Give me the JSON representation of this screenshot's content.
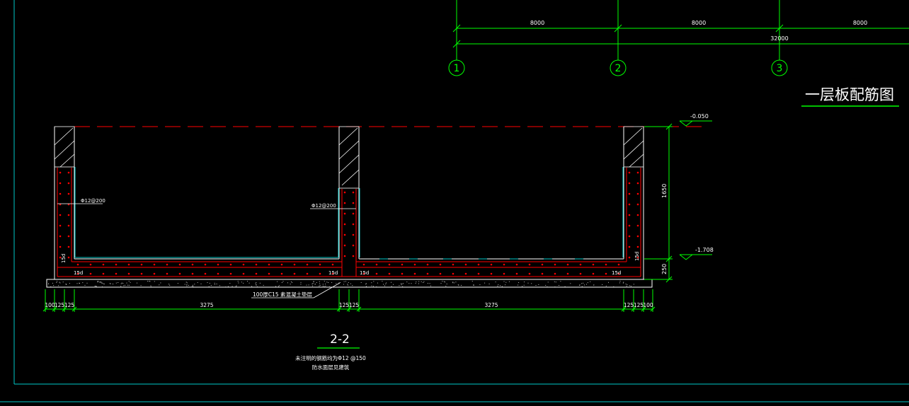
{
  "colors": {
    "background": "#000000",
    "frame": "#00c8c8",
    "grid": "#00ff00",
    "dim": "#00ff00",
    "concrete": "#ffffff",
    "rebar": "#ff0000",
    "text": "#ffffff",
    "leader": "#00c8c8",
    "elevation": "#00ff00"
  },
  "plan": {
    "span_dims": [
      "8000",
      "8000",
      "8000"
    ],
    "total_dim": "32000",
    "axes": [
      "1",
      "2",
      "3"
    ],
    "title": "一层板配筋图"
  },
  "section": {
    "elev_top": "-0.050",
    "elev_bottom": "-1.708",
    "height_dim": "1650",
    "slab_dim": "250",
    "rebar_label_left": "Φ12@200",
    "rebar_label_mid": "Φ12@200",
    "anchor_labels": [
      "15d",
      "15d",
      "15d",
      "15d",
      "15d",
      "15d"
    ],
    "cushion_note": "100厚C15 素混凝土垫层",
    "bottom_dims": [
      "100",
      "125",
      "125",
      "3275",
      "125",
      "125",
      "3275",
      "125",
      "125",
      "100"
    ],
    "title": "2-2",
    "note_line1": "未注明的钢筋均为Φ12 @150",
    "note_line2": "防水面层见建筑"
  }
}
